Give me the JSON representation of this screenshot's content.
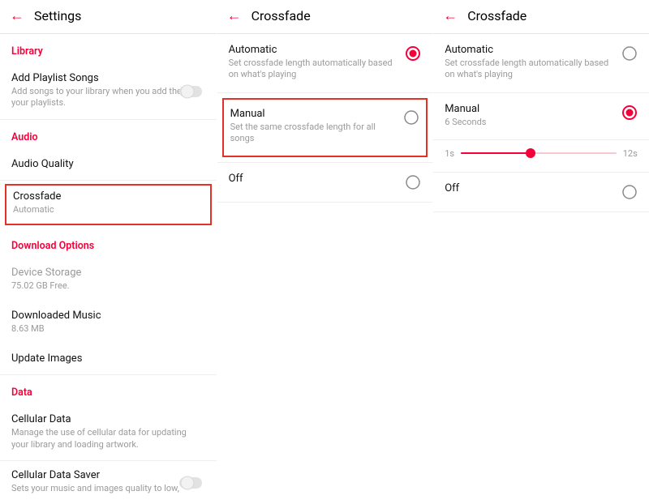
{
  "colors": {
    "accent": "#f50039",
    "highlight_border": "#e33126"
  },
  "panelA": {
    "header_title": "Settings",
    "sections": {
      "library": {
        "title": "Library",
        "add_playlist": {
          "title": "Add Playlist Songs",
          "sub": "Add songs to your library when you add them to your playlists."
        }
      },
      "audio": {
        "title": "Audio",
        "audio_quality": {
          "title": "Audio Quality"
        },
        "crossfade": {
          "title": "Crossfade",
          "sub": "Automatic"
        }
      },
      "download": {
        "title": "Download Options",
        "device_storage": {
          "title": "Device Storage",
          "sub": "75.02 GB Free."
        },
        "downloaded_music": {
          "title": "Downloaded Music",
          "sub": "8.63 MB"
        },
        "update_images": {
          "title": "Update Images"
        }
      },
      "data": {
        "title": "Data",
        "cellular_data": {
          "title": "Cellular Data",
          "sub": "Manage the use of cellular data for updating your library and loading artwork."
        },
        "cellular_data_saver": {
          "title": "Cellular Data Saver",
          "sub": "Sets your music and images quality to low,"
        }
      }
    }
  },
  "panelB": {
    "header_title": "Crossfade",
    "automatic": {
      "title": "Automatic",
      "sub": "Set crossfade length automatically based on what's playing",
      "selected": true
    },
    "manual": {
      "title": "Manual",
      "sub": "Set the same crossfade length for all songs",
      "selected": false
    },
    "off": {
      "title": "Off",
      "selected": false
    }
  },
  "panelC": {
    "header_title": "Crossfade",
    "automatic": {
      "title": "Automatic",
      "sub": "Set crossfade length automatically based on what's playing",
      "selected": false
    },
    "manual": {
      "title": "Manual",
      "sub": "6 Seconds",
      "selected": true
    },
    "slider": {
      "min_label": "1s",
      "max_label": "12s",
      "value_percent": 45
    },
    "off": {
      "title": "Off",
      "selected": false
    }
  }
}
